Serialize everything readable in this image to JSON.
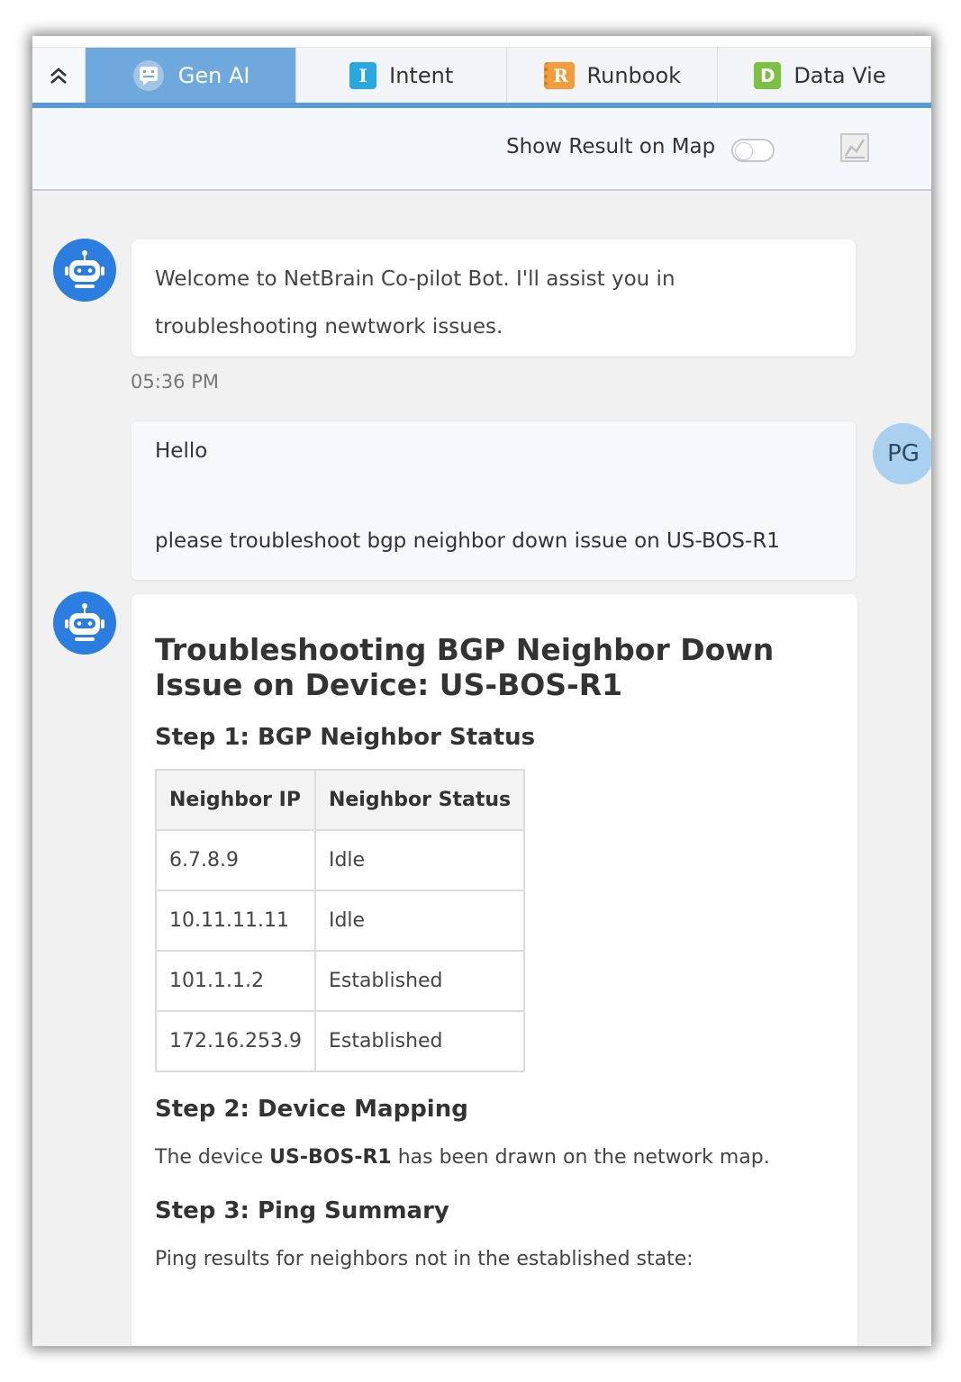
{
  "tabs": [
    {
      "label": "Gen AI",
      "icon": "chat-bot-icon",
      "active": true
    },
    {
      "label": "Intent",
      "icon": "intent-icon",
      "icon_letter": "I",
      "color": "#29a8e0"
    },
    {
      "label": "Runbook",
      "icon": "runbook-icon",
      "icon_letter": "R",
      "color": "#f39c3c"
    },
    {
      "label": "Data Vie",
      "icon": "data-view-icon",
      "icon_letter": "D",
      "color": "#7cc242"
    }
  ],
  "toolbar": {
    "show_result_label": "Show Result on Map",
    "show_result_enabled": false
  },
  "chat": {
    "welcome_line1": "Welcome to NetBrain Co-pilot Bot. I'll assist you in",
    "welcome_line2": "troubleshooting newtwork issues.",
    "timestamp": "05:36 PM",
    "user_line1": "Hello",
    "user_line2": "please troubleshoot bgp neighbor down issue on US-BOS-R1",
    "user_initials": "PG"
  },
  "answer": {
    "title": "Troubleshooting BGP Neighbor Down Issue on Device: US-BOS-R1",
    "step1_heading": "Step 1: BGP Neighbor Status",
    "table_headers": [
      "Neighbor IP",
      "Neighbor Status"
    ],
    "table_rows": [
      [
        "6.7.8.9",
        "Idle"
      ],
      [
        "10.11.11.11",
        "Idle"
      ],
      [
        "101.1.1.2",
        "Established"
      ],
      [
        "172.16.253.9",
        "Established"
      ]
    ],
    "step2_heading": "Step 2: Device Mapping",
    "step2_prefix": "The device ",
    "step2_device": "US-BOS-R1",
    "step2_suffix": " has been drawn on the network map.",
    "step3_heading": "Step 3: Ping Summary",
    "step3_text": "Ping results for neighbors not in the established state:"
  },
  "colors": {
    "accent": "#6fa8dc",
    "bot_avatar": "#2b7de0",
    "user_avatar": "#a9d1ef"
  }
}
